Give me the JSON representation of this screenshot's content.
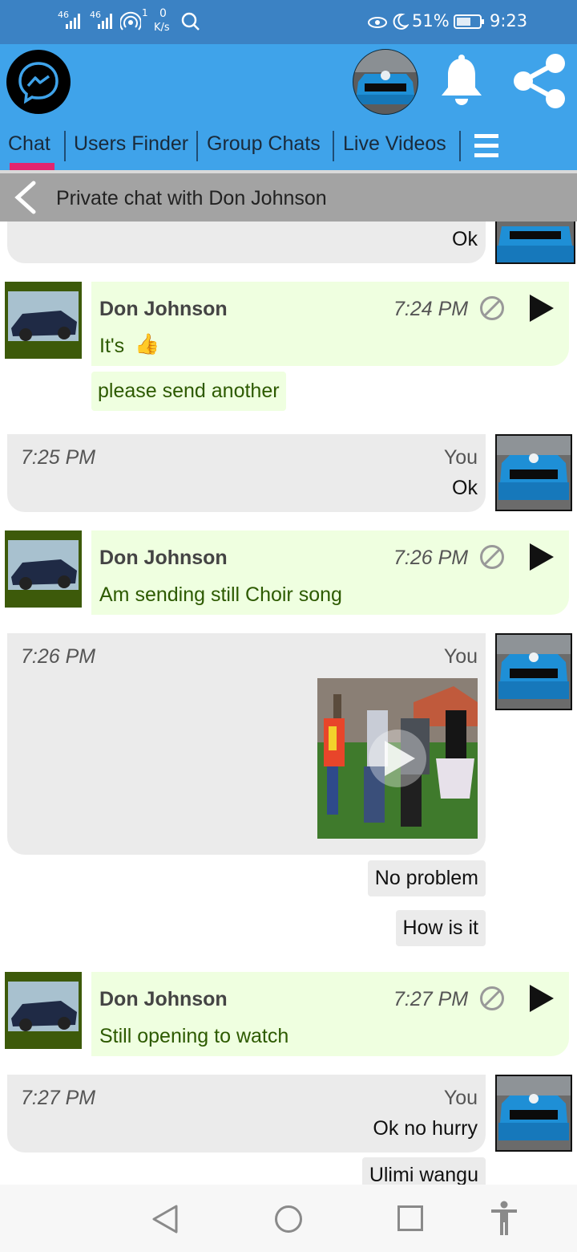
{
  "status_bar": {
    "network_1": "46",
    "network_2": "46",
    "hotspot_count": "1",
    "speed_value": "0",
    "speed_unit": "K/s",
    "battery": "51%",
    "time": "9:23"
  },
  "header": {
    "logo_icon": "messenger-icon",
    "bell_icon": "bell-icon",
    "share_icon": "share-icon",
    "menu_icon": "hamburger-icon"
  },
  "tabs": [
    {
      "label": "Chat",
      "active": true
    },
    {
      "label": "Users Finder"
    },
    {
      "label": "Group Chats"
    },
    {
      "label": "Live Videos"
    }
  ],
  "subheader": {
    "title": "Private chat with Don Johnson"
  },
  "messages": [
    {
      "type": "out",
      "text": "Ok"
    },
    {
      "type": "in",
      "sender": "Don Johnson",
      "time": "7:24 PM",
      "text": "It's",
      "emoji": "👍"
    },
    {
      "type": "in-followup",
      "text": "please send another"
    },
    {
      "type": "out",
      "time": "7:25 PM",
      "author": "You",
      "text": "Ok"
    },
    {
      "type": "in",
      "sender": "Don Johnson",
      "time": "7:26 PM",
      "text": "Am sending still Choir song"
    },
    {
      "type": "out-video",
      "time": "7:26 PM",
      "author": "You"
    },
    {
      "type": "out-followup",
      "text": "No problem"
    },
    {
      "type": "out-followup",
      "text": "How is it"
    },
    {
      "type": "in",
      "sender": "Don Johnson",
      "time": "7:27 PM",
      "text": "Still opening to watch"
    },
    {
      "type": "out",
      "time": "7:27 PM",
      "author": "You",
      "text": "Ok no hurry"
    },
    {
      "type": "out-followup",
      "text": "Ulimi wangu"
    }
  ],
  "colors": {
    "status_bar": "#3b82c4",
    "header": "#3fa3ea",
    "tab_active_underline": "#e2256f",
    "incoming_bubble": "#efffe0",
    "outgoing_bubble": "#ebebeb",
    "incoming_text": "#2d5a00"
  },
  "nav_bar": {
    "back_icon": "triangle-back-icon",
    "home_icon": "circle-home-icon",
    "recents_icon": "square-recents-icon",
    "accessibility_icon": "accessibility-icon"
  }
}
